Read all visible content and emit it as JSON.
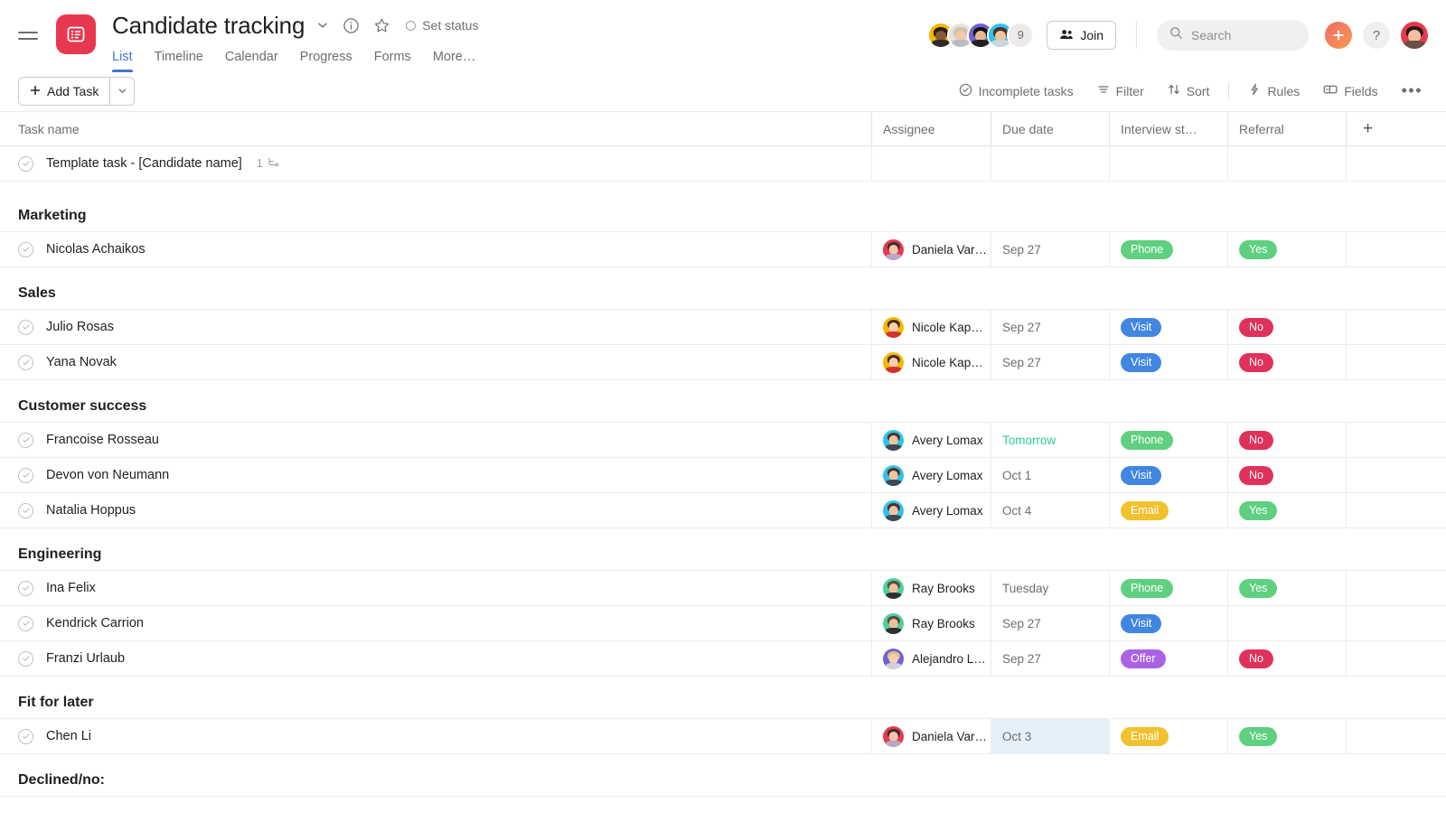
{
  "header": {
    "menu_icon": "hamburger-icon",
    "logo_icon": "list-project-icon",
    "title": "Candidate tracking",
    "dropdown_icon": "chevron-down-icon",
    "info_icon": "info-circle-icon",
    "star_icon": "star-icon",
    "set_status_label": "Set status",
    "tabs": [
      {
        "label": "List",
        "active": true
      },
      {
        "label": "Timeline",
        "active": false
      },
      {
        "label": "Calendar",
        "active": false
      },
      {
        "label": "Progress",
        "active": false
      },
      {
        "label": "Forms",
        "active": false
      },
      {
        "label": "More…",
        "active": false
      }
    ],
    "member_overflow_count": "9",
    "join_label": "Join",
    "join_icon": "people-icon",
    "search_placeholder": "Search",
    "search_icon": "search-icon",
    "add_icon": "plus-icon",
    "help_label": "?",
    "account_avatar": "user-avatar"
  },
  "toolbar": {
    "add_task_label": "Add Task",
    "add_task_plus_icon": "plus-icon",
    "add_task_caret_icon": "chevron-down-icon",
    "items": [
      {
        "label": "Incomplete tasks",
        "icon": "check-circle-icon"
      },
      {
        "label": "Filter",
        "icon": "filter-icon"
      },
      {
        "label": "Sort",
        "icon": "sort-arrows-icon"
      },
      {
        "label": "Rules",
        "icon": "lightning-bolt-icon"
      },
      {
        "label": "Fields",
        "icon": "fields-icon"
      }
    ],
    "overflow_label": "•••"
  },
  "grid": {
    "columns": [
      {
        "key": "name",
        "label": "Task name"
      },
      {
        "key": "assignee",
        "label": "Assignee"
      },
      {
        "key": "due",
        "label": "Due date"
      },
      {
        "key": "status",
        "label": "Interview st…"
      },
      {
        "key": "referral",
        "label": "Referral"
      }
    ],
    "add_column_icon": "plus-icon",
    "template_row": {
      "name": "Template task - [Candidate name]",
      "subtask_count": "1",
      "subtask_icon": "subtask-icon",
      "assignee": "",
      "due": "",
      "status": "",
      "referral": ""
    },
    "sections": [
      {
        "title": "Marketing",
        "tasks": [
          {
            "name": "Nicolas Achaikos",
            "assignee": "Daniela Var…",
            "assignee_avatar": {
              "bg": "#e8384f",
              "hair": "#3b2f2b",
              "skin": "#f2c6a8",
              "body": "#b8a7c9"
            },
            "due": "Sep 27",
            "due_style": "normal",
            "status": {
              "label": "Phone",
              "color": "#5fd07f"
            },
            "referral": {
              "label": "Yes",
              "color": "#5fd07f"
            }
          }
        ]
      },
      {
        "title": "Sales",
        "tasks": [
          {
            "name": "Julio Rosas",
            "assignee": "Nicole Kap…",
            "assignee_avatar": {
              "bg": "#f5b800",
              "hair": "#4a2c1e",
              "skin": "#f6cfae",
              "body": "#d0342c"
            },
            "due": "Sep 27",
            "due_style": "normal",
            "status": {
              "label": "Visit",
              "color": "#4186e0"
            },
            "referral": {
              "label": "No",
              "color": "#e0315c"
            }
          },
          {
            "name": "Yana Novak",
            "assignee": "Nicole Kap…",
            "assignee_avatar": {
              "bg": "#f5b800",
              "hair": "#4a2c1e",
              "skin": "#f6cfae",
              "body": "#d0342c"
            },
            "due": "Sep 27",
            "due_style": "normal",
            "status": {
              "label": "Visit",
              "color": "#4186e0"
            },
            "referral": {
              "label": "No",
              "color": "#e0315c"
            }
          }
        ]
      },
      {
        "title": "Customer success",
        "tasks": [
          {
            "name": "Francoise Rosseau",
            "assignee": "Avery Lomax",
            "assignee_avatar": {
              "bg": "#2ec2f0",
              "hair": "#4a332a",
              "skin": "#f0c49b",
              "body": "#3e4752"
            },
            "due": "Tomorrow",
            "due_style": "tomorrow",
            "status": {
              "label": "Phone",
              "color": "#5fd07f"
            },
            "referral": {
              "label": "No",
              "color": "#e0315c"
            }
          },
          {
            "name": "Devon von Neumann",
            "assignee": "Avery Lomax",
            "assignee_avatar": {
              "bg": "#2ec2f0",
              "hair": "#4a332a",
              "skin": "#f0c49b",
              "body": "#3e4752"
            },
            "due": "Oct 1",
            "due_style": "normal",
            "status": {
              "label": "Visit",
              "color": "#4186e0"
            },
            "referral": {
              "label": "No",
              "color": "#e0315c"
            }
          },
          {
            "name": "Natalia Hoppus",
            "assignee": "Avery Lomax",
            "assignee_avatar": {
              "bg": "#2ec2f0",
              "hair": "#4a332a",
              "skin": "#f0c49b",
              "body": "#3e4752"
            },
            "due": "Oct 4",
            "due_style": "normal",
            "status": {
              "label": "Email",
              "color": "#f2c12e"
            },
            "referral": {
              "label": "Yes",
              "color": "#5fd07f"
            }
          }
        ]
      },
      {
        "title": "Engineering",
        "tasks": [
          {
            "name": "Ina Felix",
            "assignee": "Ray Brooks",
            "assignee_avatar": {
              "bg": "#4ecf9a",
              "hair": "#5a4a3c",
              "skin": "#eec19c",
              "body": "#2c2f33"
            },
            "due": "Tuesday",
            "due_style": "normal",
            "status": {
              "label": "Phone",
              "color": "#5fd07f"
            },
            "referral": {
              "label": "Yes",
              "color": "#5fd07f"
            }
          },
          {
            "name": "Kendrick Carrion",
            "assignee": "Ray Brooks",
            "assignee_avatar": {
              "bg": "#4ecf9a",
              "hair": "#5a4a3c",
              "skin": "#eec19c",
              "body": "#2c2f33"
            },
            "due": "Sep 27",
            "due_style": "normal",
            "status": {
              "label": "Visit",
              "color": "#4186e0"
            },
            "referral": null
          },
          {
            "name": "Franzi Urlaub",
            "assignee": "Alejandro L…",
            "assignee_avatar": {
              "bg": "#6e62d6",
              "hair": "#d9c58a",
              "skin": "#f3cfae",
              "body": "#cfd3da"
            },
            "due": "Sep 27",
            "due_style": "normal",
            "status": {
              "label": "Offer",
              "color": "#aa62e3"
            },
            "referral": {
              "label": "No",
              "color": "#e0315c"
            }
          }
        ]
      },
      {
        "title": "Fit for later",
        "tasks": [
          {
            "name": "Chen Li",
            "assignee": "Daniela Var…",
            "assignee_avatar": {
              "bg": "#e8384f",
              "hair": "#3b2f2b",
              "skin": "#f2c6a8",
              "body": "#b8a7c9"
            },
            "due": "Oct 3",
            "due_style": "selected",
            "status": {
              "label": "Email",
              "color": "#f2c12e"
            },
            "referral": {
              "label": "Yes",
              "color": "#5fd07f"
            }
          }
        ]
      },
      {
        "title": "Declined/no:",
        "tasks": []
      }
    ]
  },
  "colors": {
    "brand_red": "#e8384f",
    "accent_blue": "#4573d2",
    "green": "#5fd07f",
    "blue": "#4186e0",
    "yellow": "#f2c12e",
    "purple": "#aa62e3",
    "red": "#e0315c",
    "teal_text": "#2ec9a0",
    "selected_cell": "#e4eff7"
  }
}
